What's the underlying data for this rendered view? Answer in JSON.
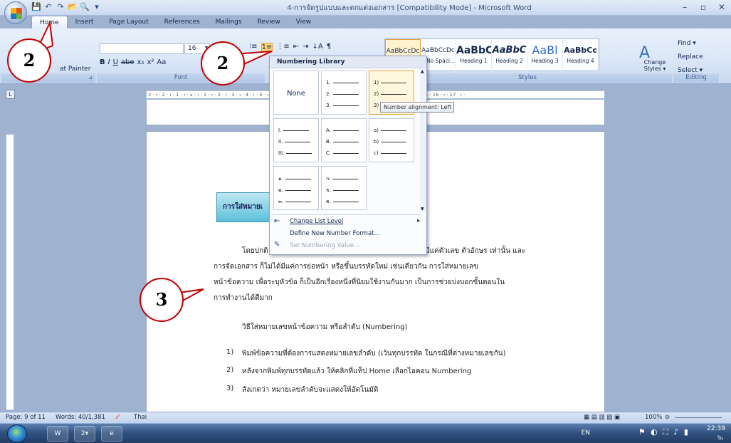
{
  "window": {
    "title": "4-การจัดรูปแบบและตกแต่งเอกสาร [Compatibility Mode] - Microsoft Word",
    "controls": [
      "–",
      "▫",
      "✕"
    ]
  },
  "quick_access": [
    "💾",
    "↶",
    "↷",
    "📂",
    "🔍",
    "▾"
  ],
  "tabs": [
    "Home",
    "Insert",
    "Page Layout",
    "References",
    "Mailings",
    "Review",
    "View"
  ],
  "ribbon": {
    "clipboard": {
      "format_painter": "at Painter",
      "label": ""
    },
    "font": {
      "size": "16",
      "label": "Font",
      "buttons": [
        "B",
        "I",
        "U",
        "abe",
        "x₂",
        "x²",
        "Aa"
      ]
    },
    "paragraph": {
      "buttons": [
        "⁝≡",
        "1≡",
        "⋮≡",
        "⇤",
        "⇥",
        "↓A",
        "¶"
      ]
    },
    "styles": {
      "label": "Styles",
      "items": [
        {
          "sample": "AaBbCcDc",
          "name": ""
        },
        {
          "sample": "AaBbCcDc",
          "name": "¶ No Spaci..."
        },
        {
          "sample": "AaBbC",
          "name": "Heading 1"
        },
        {
          "sample": "AaBbC",
          "name": "Heading 2"
        },
        {
          "sample": "AaBl",
          "name": "Heading 3"
        },
        {
          "sample": "AaBbCc",
          "name": "Heading 4"
        }
      ],
      "change_styles": "Change Styles",
      "change_styles_arrow": "▾"
    },
    "editing": {
      "label": "Editing",
      "find": "Find ▾",
      "replace": "Replace",
      "select": "Select ▾"
    }
  },
  "ruler": {
    "ticks": "3 · ı · 2 · ı · 1 · ı · ⩓ · ı · 1 · ı · 2 · ı · 3 · ı · 4 · ı · 5 · ı · 6 · ı · 7 · ı · 8 · ı · 9 · ı · 10 · ı · 11 · ı · 12 · ı · 13 · ı · 14 · ı · 15 · ⩓ · 16 · ı · 17 · ı ·",
    "corner": "L"
  },
  "numbering_library": {
    "header": "Numbering Library",
    "tiles": [
      {
        "kind": "none",
        "label": "None"
      },
      {
        "kind": "list",
        "items": [
          "1.",
          "2.",
          "3."
        ]
      },
      {
        "kind": "list",
        "items": [
          "1)",
          "2)",
          "3)"
        ]
      },
      {
        "kind": "list",
        "items": [
          "I.",
          "II.",
          "III."
        ]
      },
      {
        "kind": "list",
        "items": [
          "A.",
          "B.",
          "C."
        ]
      },
      {
        "kind": "list",
        "items": [
          "a)",
          "b)",
          "c)"
        ]
      },
      {
        "kind": "list",
        "items": [
          "๑.",
          "๒.",
          "๓."
        ]
      },
      {
        "kind": "list",
        "items": [
          "ก.",
          "ข.",
          "ค."
        ]
      }
    ],
    "tooltip": "Number alignment: Left",
    "menu": [
      {
        "label": "Change List Level",
        "submenu_arrow": "▸",
        "enabled": true
      },
      {
        "label": "Define New Number Format...",
        "enabled": true
      },
      {
        "label": "Set Numbering Value...",
        "enabled": false
      }
    ]
  },
  "callouts": [
    "2",
    "2",
    "3"
  ],
  "document": {
    "heading": "การใส่หมายเ",
    "paragraph": [
      "โดยปกติ",
      "มีแค่ตัวเลข ตัวอักษร เท่านั้น และ",
      "การจัดเอกสาร ก็ไม่ได้มีแค่การย่อหน้า หรือขึ้นบรรทัดใหม่ เช่นเดียวกัน การใส่หมายเลข",
      "หน้าข้อความ เพื่อระบุหัวข้อ ก็เป็นอีกเรื่องหนึ่งที่นิยมใช้งานกันมาก เป็นการช่วยบ่งบอกขั้นตอนใน",
      "การทำงานได้ดีมาก"
    ],
    "subheading": "วิธีใส่หมายเลขหน้าข้อความ หรือลำดับ (Numbering)",
    "steps": [
      {
        "num": "1)",
        "text": "พิมพ์ข้อความที่ต้องการแสดงหมายเลขลำดับ (เว้นทุกบรรทัด ในกรณีที่ต่างหมายเลขกัน)"
      },
      {
        "num": "2)",
        "text": "หลังจากพิมพ์ทุกบรรทัดแล้ว ให้คลิกที่แท็ป Home เลือกไอคอน Numbering"
      },
      {
        "num": "3)",
        "text": "สังเกตว่า หมายเลขลำดับจะแสดงให้อัตโนมัติ"
      }
    ]
  },
  "statusbar": {
    "page": "Page: 9 of 11",
    "words": "Words: 40/1,381",
    "language": "Thai",
    "zoom": "100%"
  },
  "taskbar": {
    "apps": [
      "W",
      "2▾",
      "e"
    ],
    "lang": "EN",
    "time": "22:39",
    "date": "วันอาร"
  },
  "colors": {
    "ribbon": "#dae6f7",
    "callout_border": "#c00000",
    "heading_box": "#5bc0d8",
    "highlight": "#e6a23c"
  }
}
